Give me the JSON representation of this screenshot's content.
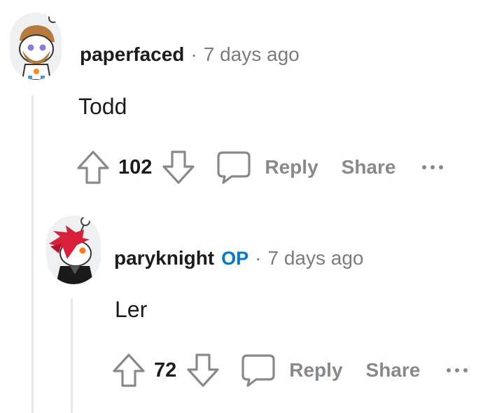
{
  "comments": [
    {
      "username": "paperfaced",
      "separator": "·",
      "time": "7 days ago",
      "body": "Todd",
      "score": "102",
      "reply_label": "Reply",
      "share_label": "Share",
      "more_icon": "ellipsis-icon"
    },
    {
      "username": "paryknight",
      "op_badge": "OP",
      "separator": "·",
      "time": "7 days ago",
      "body": "Ler",
      "score": "72",
      "reply_label": "Reply",
      "share_label": "Share",
      "more_icon": "ellipsis-icon"
    }
  ],
  "colors": {
    "text": "#1c1c1c",
    "muted": "#7c7c7c",
    "action": "#878a8c",
    "op_badge": "#0079d3",
    "thread_line": "#e5e8ea"
  },
  "icons": [
    "upvote-icon",
    "downvote-icon",
    "comment-icon",
    "ellipsis-icon"
  ]
}
